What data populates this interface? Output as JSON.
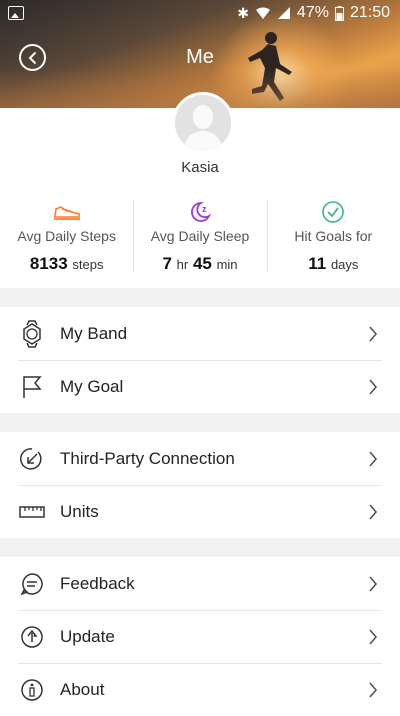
{
  "status_bar": {
    "battery_percent": "47%",
    "time": "21:50"
  },
  "header": {
    "title": "Me"
  },
  "profile": {
    "name": "Kasia"
  },
  "stats": [
    {
      "label": "Avg Daily Steps",
      "value": "8133",
      "unit": "steps",
      "icon": "sneaker-icon",
      "color": "#ff7a2b"
    },
    {
      "label": "Avg Daily Sleep",
      "hours": "7",
      "hours_unit": "hr",
      "minutes": "45",
      "minutes_unit": "min",
      "icon": "moon-sleep-icon",
      "color": "#9b3ad9"
    },
    {
      "label": "Hit Goals for",
      "value": "11",
      "unit": "days",
      "icon": "check-circle-icon",
      "color": "#3bb58a"
    }
  ],
  "menu": {
    "group1": [
      {
        "label": "My Band",
        "icon": "watch-icon"
      },
      {
        "label": "My Goal",
        "icon": "flag-icon"
      }
    ],
    "group2": [
      {
        "label": "Third-Party Connection",
        "icon": "link-arrow-icon"
      },
      {
        "label": "Units",
        "icon": "ruler-icon"
      }
    ],
    "group3": [
      {
        "label": "Feedback",
        "icon": "chat-icon"
      },
      {
        "label": "Update",
        "icon": "upload-icon"
      },
      {
        "label": "About",
        "icon": "info-icon"
      }
    ]
  }
}
